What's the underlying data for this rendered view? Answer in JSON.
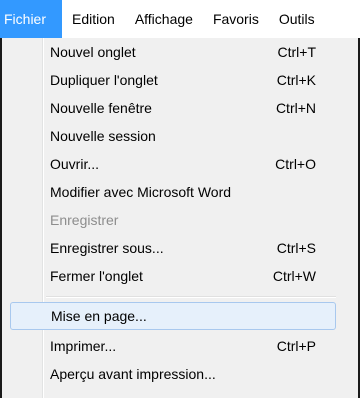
{
  "menubar": {
    "items": [
      {
        "label": "Fichier",
        "active": true
      },
      {
        "label": "Edition"
      },
      {
        "label": "Affichage"
      },
      {
        "label": "Favoris"
      },
      {
        "label": "Outils"
      }
    ]
  },
  "menu": {
    "items": [
      {
        "label": "Nouvel onglet",
        "shortcut": "Ctrl+T"
      },
      {
        "label": "Dupliquer l'onglet",
        "shortcut": "Ctrl+K"
      },
      {
        "label": "Nouvelle fenêtre",
        "shortcut": "Ctrl+N"
      },
      {
        "label": "Nouvelle session",
        "shortcut": ""
      },
      {
        "label": "Ouvrir...",
        "shortcut": "Ctrl+O"
      },
      {
        "label": "Modifier avec Microsoft Word",
        "shortcut": ""
      },
      {
        "label": "Enregistrer",
        "shortcut": "",
        "disabled": true
      },
      {
        "label": "Enregistrer sous...",
        "shortcut": "Ctrl+S"
      },
      {
        "label": "Fermer l'onglet",
        "shortcut": "Ctrl+W"
      },
      {
        "label": "Mise en page...",
        "shortcut": "",
        "hover": true
      },
      {
        "label": "Imprimer...",
        "shortcut": "Ctrl+P"
      },
      {
        "label": "Aperçu avant impression...",
        "shortcut": ""
      }
    ]
  },
  "colors": {
    "active_menu_bg": "#3399ff",
    "menu_bg": "#f0f0f0",
    "disabled_text": "#8d8d8d",
    "hover_bg": "#e6f0fb",
    "hover_border": "#a8c8ee"
  }
}
